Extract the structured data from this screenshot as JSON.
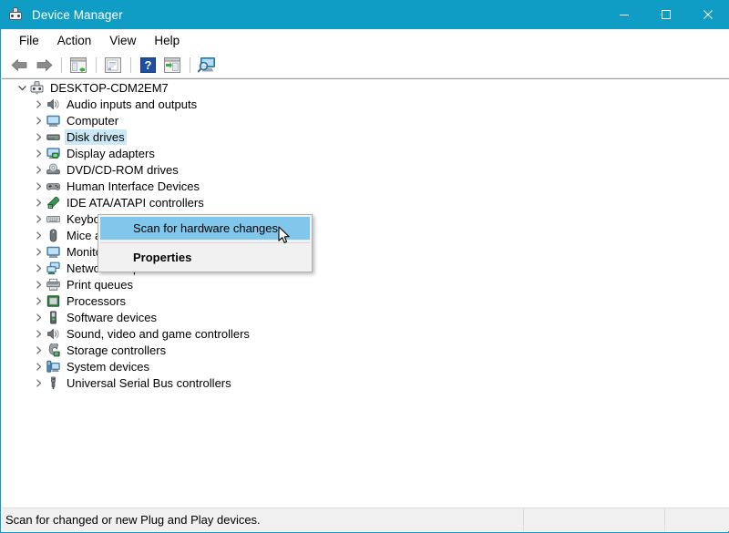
{
  "window": {
    "title": "Device Manager",
    "title_icon": "device-manager-icon",
    "controls": {
      "minimize": "minimize-icon",
      "maximize": "maximize-icon",
      "close": "close-icon"
    },
    "accent_color": "#0f9dc6"
  },
  "menubar": {
    "items": [
      {
        "label": "File"
      },
      {
        "label": "Action"
      },
      {
        "label": "View"
      },
      {
        "label": "Help"
      }
    ]
  },
  "toolbar": {
    "buttons": [
      {
        "name": "back-button",
        "icon": "back-arrow-icon"
      },
      {
        "name": "forward-button",
        "icon": "forward-arrow-icon"
      },
      {
        "name": "show-hide-console-tree-button",
        "icon": "console-tree-icon"
      },
      {
        "name": "properties-button",
        "icon": "properties-page-icon"
      },
      {
        "name": "help-button",
        "icon": "help-question-icon"
      },
      {
        "name": "update-driver-button",
        "icon": "update-driver-icon"
      },
      {
        "name": "scan-for-hardware-changes-button",
        "icon": "scan-hardware-icon"
      }
    ]
  },
  "tree": {
    "root": {
      "label": "DESKTOP-CDM2EM7",
      "icon": "computer-root-icon",
      "expanded": true
    },
    "items": [
      {
        "label": "Audio inputs and outputs",
        "icon": "speaker-icon"
      },
      {
        "label": "Computer",
        "icon": "monitor-icon"
      },
      {
        "label": "Disk drives",
        "icon": "disk-drive-icon",
        "selected": true
      },
      {
        "label": "Display adapters",
        "icon": "display-adapter-icon"
      },
      {
        "label": "DVD/CD-ROM drives",
        "icon": "dvd-drive-icon"
      },
      {
        "label": "Human Interface Devices",
        "icon": "hid-gamepad-icon"
      },
      {
        "label": "IDE ATA/ATAPI controllers",
        "icon": "ide-controller-icon"
      },
      {
        "label": "Keyboards",
        "icon": "keyboard-icon"
      },
      {
        "label": "Mice and other pointing devices",
        "icon": "mouse-icon"
      },
      {
        "label": "Monitors",
        "icon": "monitor-icon"
      },
      {
        "label": "Network adapters",
        "icon": "network-adapter-icon"
      },
      {
        "label": "Print queues",
        "icon": "printer-icon"
      },
      {
        "label": "Processors",
        "icon": "processor-chip-icon"
      },
      {
        "label": "Software devices",
        "icon": "software-device-icon"
      },
      {
        "label": "Sound, video and game controllers",
        "icon": "speaker-icon"
      },
      {
        "label": "Storage controllers",
        "icon": "storage-controller-icon"
      },
      {
        "label": "System devices",
        "icon": "system-device-icon"
      },
      {
        "label": "Universal Serial Bus controllers",
        "icon": "usb-icon"
      }
    ]
  },
  "context_menu": {
    "items": [
      {
        "label": "Scan for hardware changes",
        "highlighted": true,
        "bold": false
      },
      {
        "label": "Properties",
        "highlighted": false,
        "bold": true
      }
    ],
    "highlight_color": "#81c7ec"
  },
  "cursor": {
    "icon": "arrow-pointer-cursor"
  },
  "statusbar": {
    "message": "Scan for changed or new Plug and Play devices."
  }
}
